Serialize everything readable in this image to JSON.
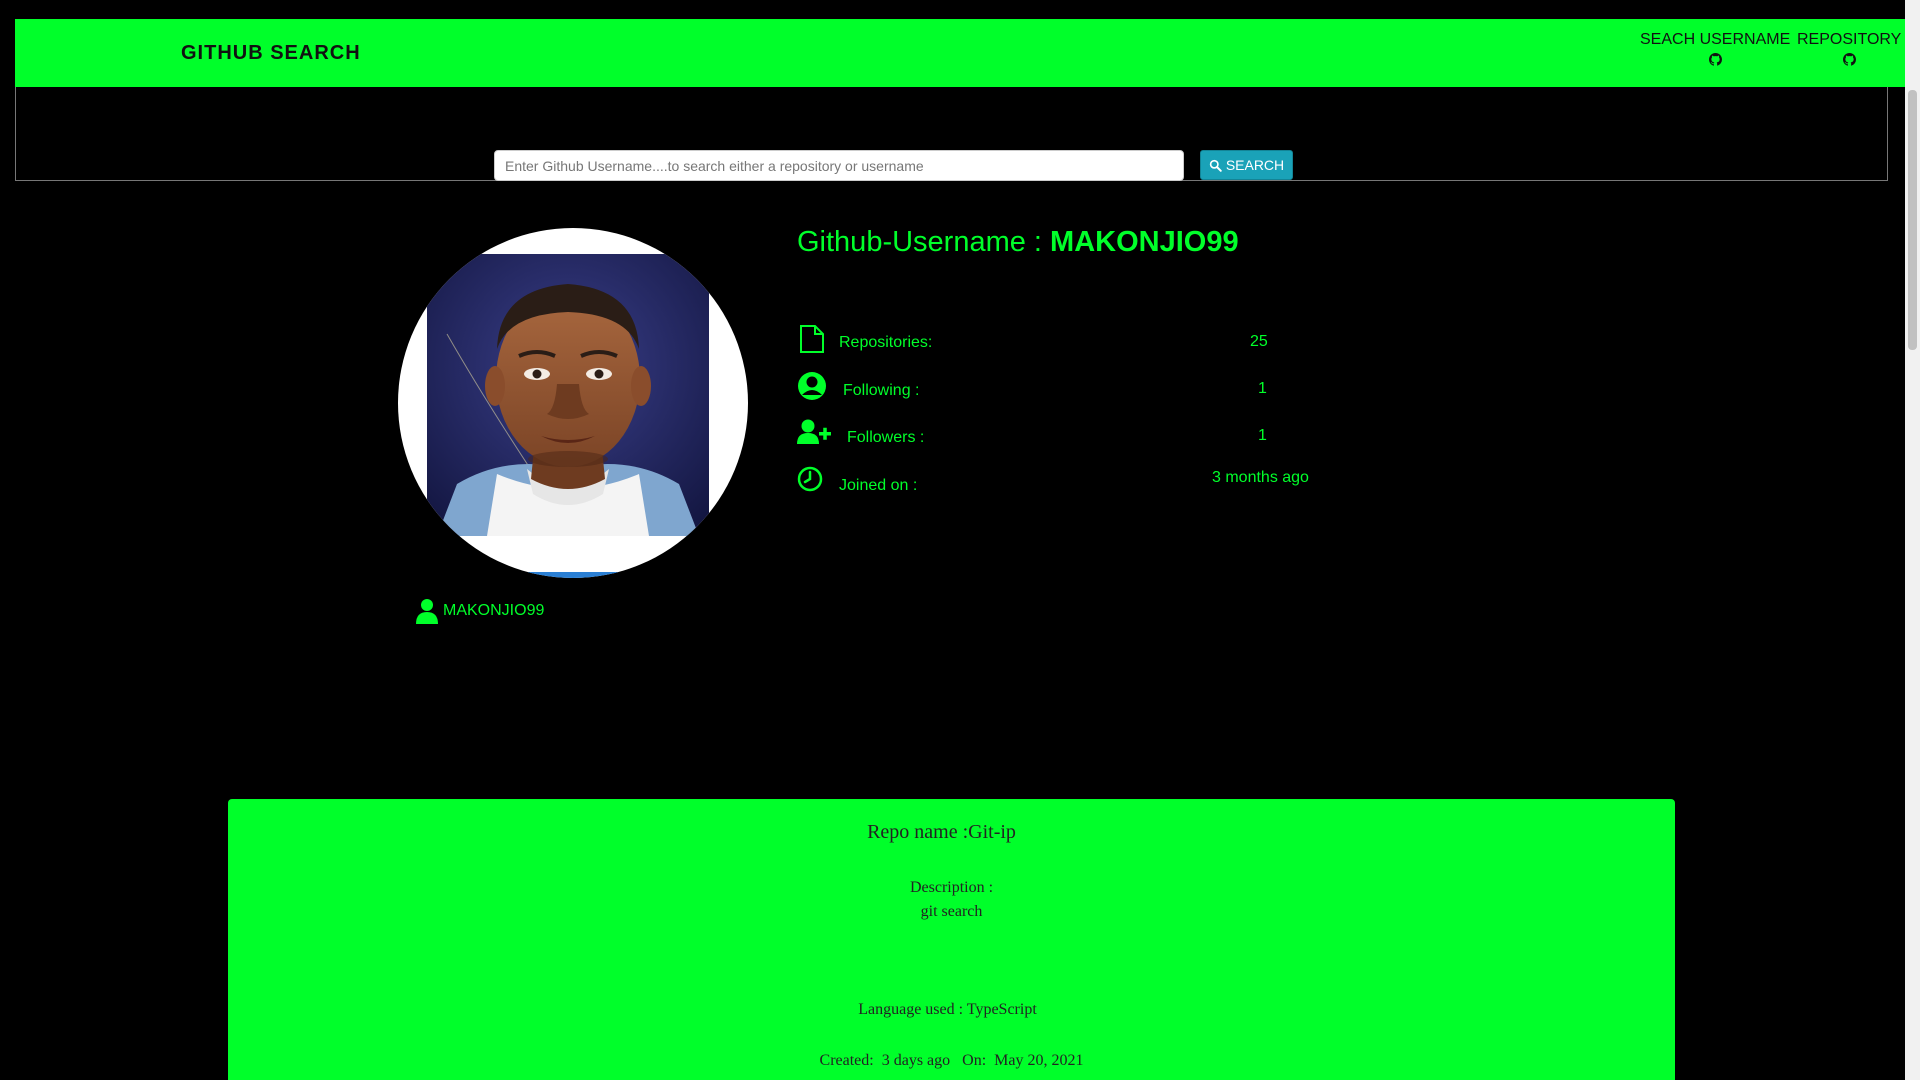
{
  "navbar": {
    "brand": "GITHUB SEARCH",
    "links": [
      {
        "label": "SEACH USERNAME",
        "icon": "github-icon"
      },
      {
        "label": "REPOSITORY",
        "icon": "github-icon"
      }
    ]
  },
  "search": {
    "placeholder": "Enter Github Username....to search either a repository or username",
    "value": "",
    "button_label": "SEARCH",
    "button_icon": "search-icon"
  },
  "profile": {
    "title_prefix": "Github-Username : ",
    "username": "MAKONJIO99",
    "display_name": "MAKONJIO99",
    "stats": [
      {
        "icon": "file-icon",
        "label": "Repositories:",
        "value": "25"
      },
      {
        "icon": "user-circle-icon",
        "label": "Following :",
        "value": "1"
      },
      {
        "icon": "user-plus-icon",
        "label": "Followers :",
        "value": "1"
      },
      {
        "icon": "clock-icon",
        "label": "Joined on :",
        "value": "3 months ago"
      }
    ]
  },
  "repo": {
    "title": "Repo name :Git-ip",
    "description_label": "Description :",
    "description": "git search",
    "language": "Language used : TypeScript",
    "created": "Created:  3 days ago   On:  May 20, 2021"
  },
  "colors": {
    "accent": "#00ff2a",
    "background": "#000000",
    "button": "#1aa2b8"
  }
}
